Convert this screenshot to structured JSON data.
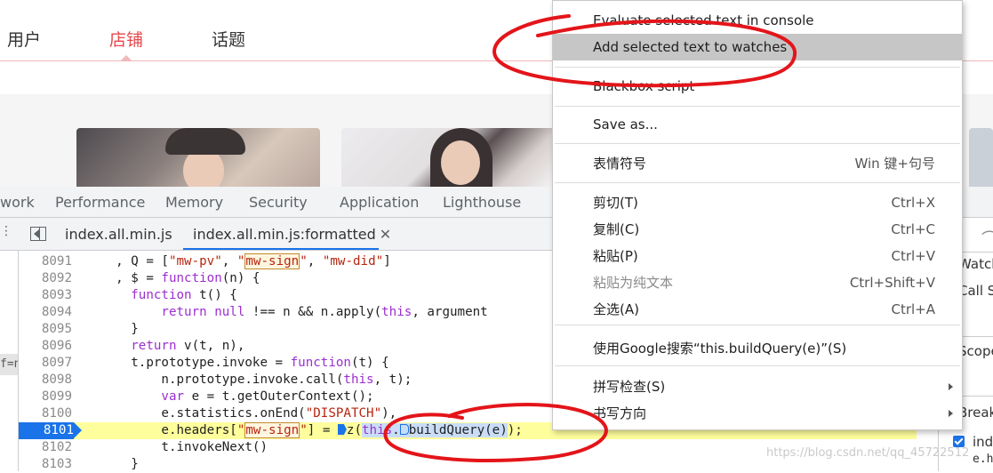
{
  "site": {
    "nav": [
      "用户",
      "店铺",
      "话题"
    ],
    "active_nav": "店铺",
    "accent_color": "#e8474b"
  },
  "devtools": {
    "tabs": [
      "work",
      "Performance",
      "Memory",
      "Security",
      "Application",
      "Lighthouse"
    ],
    "file_tabs": [
      "index.all.min.js",
      "index.all.min.js:formatted"
    ],
    "close_icon": "✕",
    "left_strip_text": "f=n",
    "right_panel": {
      "items": [
        "Watch",
        "Call S",
        "Scope",
        "Break",
        "ind",
        "e.h"
      ]
    },
    "breakpoint_color": "#1a73e8",
    "exec_line_bg": "#fffe9c"
  },
  "code": {
    "lines": [
      {
        "n": "8091",
        "text": "    , Q = [\"mw-pv\", \"mw-sign\", \"mw-did\"]"
      },
      {
        "n": "8092",
        "text": "    , $ = function(n) {"
      },
      {
        "n": "8093",
        "text": "      function t() {"
      },
      {
        "n": "8094",
        "text": "          return null !== n && n.apply(this, argument"
      },
      {
        "n": "8095",
        "text": "      }"
      },
      {
        "n": "8096",
        "text": "      return v(t, n),"
      },
      {
        "n": "8097",
        "text": "      t.prototype.invoke = function(t) {"
      },
      {
        "n": "8098",
        "text": "          n.prototype.invoke.call(this, t);"
      },
      {
        "n": "8099",
        "text": "          var e = t.getOuterContext();"
      },
      {
        "n": "8100",
        "text": "          e.statistics.onEnd(\"DISPATCH\"),"
      },
      {
        "n": "8101",
        "text": "          e.headers[\"mw-sign\"] = z(this.buildQuery(e));"
      },
      {
        "n": "8102",
        "text": "          t.invokeNext()"
      },
      {
        "n": "8103",
        "text": "      }"
      }
    ],
    "exec_line": "8101"
  },
  "context_menu": {
    "items": [
      {
        "label": "Evaluate selected text in console",
        "shortcut": ""
      },
      {
        "label": "Add selected text to watches",
        "shortcut": ""
      },
      {
        "label": "Blackbox script",
        "shortcut": ""
      },
      {
        "label": "Save as...",
        "shortcut": ""
      },
      {
        "label": "表情符号",
        "shortcut": "Win 键+句号"
      },
      {
        "label": "剪切(T)",
        "shortcut": "Ctrl+X"
      },
      {
        "label": "复制(C)",
        "shortcut": "Ctrl+C"
      },
      {
        "label": "粘贴(P)",
        "shortcut": "Ctrl+V"
      },
      {
        "label": "粘贴为纯文本",
        "shortcut": "Ctrl+Shift+V"
      },
      {
        "label": "全选(A)",
        "shortcut": "Ctrl+A"
      },
      {
        "label": "使用Google搜索“this.buildQuery(e)”(S)",
        "shortcut": ""
      },
      {
        "label": "拼写检查(S)",
        "shortcut": ""
      },
      {
        "label": "书写方向",
        "shortcut": ""
      }
    ],
    "hovered": "Add selected text to watches"
  },
  "watermark": "https://blog.csdn.net/qq_45722512",
  "annotation_color": "#e3151a"
}
